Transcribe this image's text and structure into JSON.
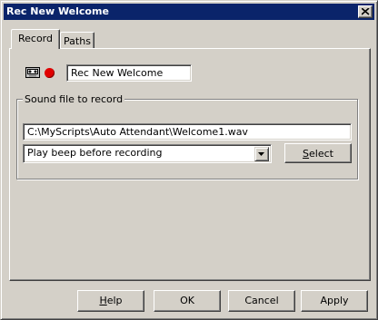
{
  "window": {
    "title": "Rec New Welcome",
    "close_icon": "close-icon",
    "title_bar_color": "#0a246a"
  },
  "tabs": [
    {
      "label": "Record",
      "active": true
    },
    {
      "label": "Paths",
      "active": false
    }
  ],
  "record": {
    "tape_icon": "cassette-icon",
    "record_indicator_icon": "record-dot-icon",
    "record_indicator_color": "#e00000",
    "name_value": "Rec New Welcome"
  },
  "sound_group": {
    "label": "Sound file to record",
    "file_path": "C:\\MyScripts\\Auto Attendant\\Welcome1.wav",
    "option_selected": "Play beep before recording",
    "select_button": {
      "label_u": "S",
      "label_rest": "elect"
    }
  },
  "buttons": {
    "help": {
      "label_u": "H",
      "label_rest": "elp"
    },
    "ok": "OK",
    "cancel": "Cancel",
    "apply": "Apply"
  }
}
